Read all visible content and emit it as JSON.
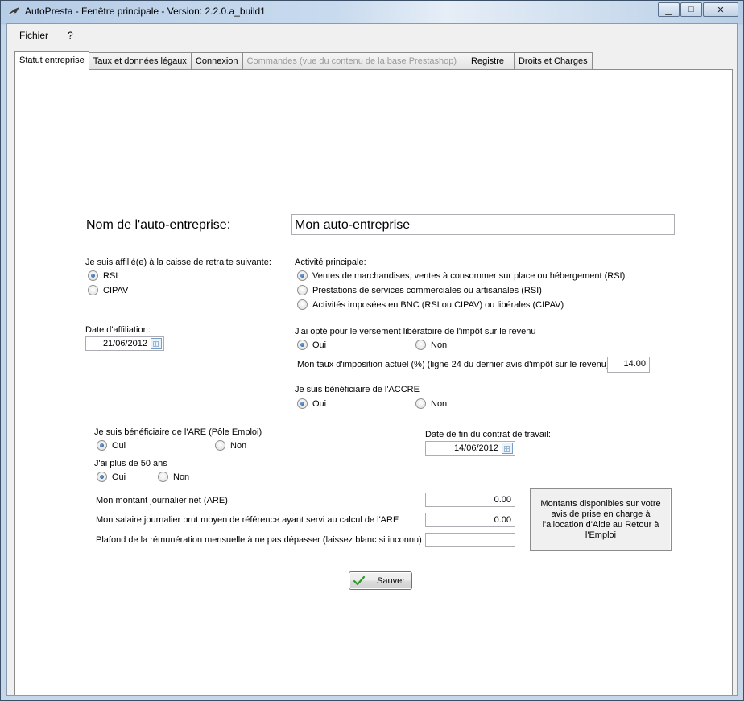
{
  "window": {
    "title": "AutoPresta - Fenêtre principale  -  Version:  2.2.0.a_build1",
    "minimize_symbol": "▁",
    "maximize_symbol": "□",
    "close_symbol": "✕"
  },
  "menu": {
    "items": [
      "Fichier",
      "?"
    ]
  },
  "tabs": [
    {
      "label": "Statut entreprise",
      "active": true,
      "disabled": false
    },
    {
      "label": "Taux et données légaux",
      "active": false,
      "disabled": false
    },
    {
      "label": "Connexion",
      "active": false,
      "disabled": false
    },
    {
      "label": "Commandes (vue du contenu de la base Prestashop)",
      "active": false,
      "disabled": true
    },
    {
      "label": "Registre",
      "active": false,
      "disabled": false
    },
    {
      "label": "Droits et Charges",
      "active": false,
      "disabled": false
    }
  ],
  "form": {
    "company_name_label": "Nom de l'auto-entreprise:",
    "company_name_value": "Mon auto-entreprise",
    "retirement": {
      "label": "Je suis affilié(e) à la caisse de retraite suivante:",
      "options": [
        {
          "label": "RSI",
          "checked": true
        },
        {
          "label": "CIPAV",
          "checked": false
        }
      ]
    },
    "affiliation_date": {
      "label": "Date d'affiliation:",
      "value": "21/06/2012"
    },
    "activity": {
      "label": "Activité principale:",
      "options": [
        {
          "label": "Ventes de marchandises, ventes à consommer sur place ou hébergement  (RSI)",
          "checked": true
        },
        {
          "label": "Prestations de services commerciales ou artisanales (RSI)",
          "checked": false
        },
        {
          "label": "Activités imposées en BNC (RSI  ou CIPAV) ou libérales (CIPAV)",
          "checked": false
        }
      ]
    },
    "versement": {
      "label": "J'ai opté pour le versement libératoire de l'impôt sur le revenu",
      "yes": "Oui",
      "no": "Non",
      "yes_checked": true
    },
    "tax_rate": {
      "label": "Mon taux d'imposition actuel (%)  (ligne 24 du dernier avis d'impôt sur le revenu)",
      "value": "14.00"
    },
    "accre": {
      "label": "Je suis bénéficiaire de l'ACCRE",
      "yes": "Oui",
      "no": "Non",
      "yes_checked": true
    },
    "are": {
      "label": "Je suis bénéficiaire de l'ARE (Pôle Emploi)",
      "yes": "Oui",
      "no": "Non",
      "yes_checked": true
    },
    "contract_end": {
      "label": "Date de fin du contrat de travail:",
      "value": "14/06/2012"
    },
    "over50": {
      "label": "J'ai plus de 50 ans",
      "yes": "Oui",
      "no": "Non",
      "yes_checked": true
    },
    "daily_net": {
      "label": "Mon montant journalier net (ARE)",
      "value": "0.00"
    },
    "daily_gross": {
      "label": "Mon salaire journalier brut moyen de référence ayant servi au calcul de l'ARE",
      "value": "0.00"
    },
    "ceiling": {
      "label": "Plafond de la rémunération mensuelle à ne pas dépasser (laissez blanc si inconnu)",
      "value": ""
    },
    "info_box": "Montants disponibles sur votre avis de prise en charge à l'allocation d'Aide au Retour à l'Emploi",
    "save_label": "Sauver"
  }
}
